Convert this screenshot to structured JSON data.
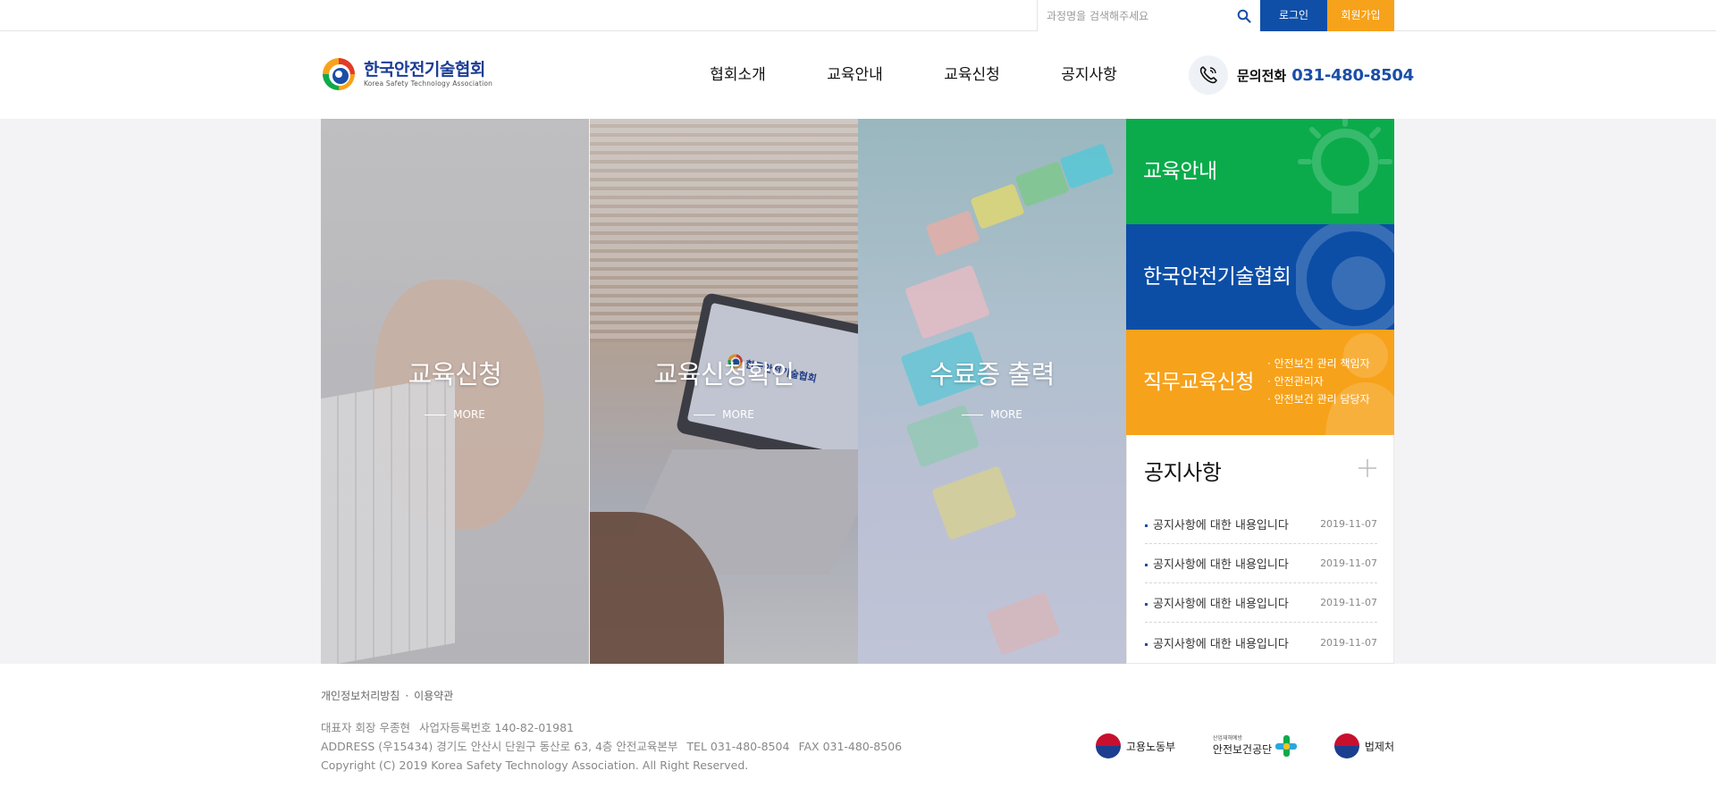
{
  "colors": {
    "primary_blue": "#0f4fa8",
    "orange": "#f7a21b",
    "green": "#0bab4b"
  },
  "top": {
    "search_placeholder": "과정명을 검색해주세요",
    "login": "로그인",
    "join": "회원가입"
  },
  "header": {
    "logo_ko": "한국안전기술협회",
    "logo_en": "Korea Safety Technology Association",
    "nav": [
      "협회소개",
      "교육안내",
      "교육신청",
      "공지사항"
    ],
    "contact_label": "문의전화",
    "contact_number": "031-480-8504"
  },
  "panels": [
    {
      "title": "교육신청",
      "more": "MORE"
    },
    {
      "title": "교육신청확인",
      "more": "MORE"
    },
    {
      "title": "수료증 출력",
      "more": "MORE"
    }
  ],
  "laptop_logo": "한국안전기술협회",
  "side": {
    "edu_info": "교육안내",
    "association": "한국안전기술협회",
    "job_training": "직무교육신청",
    "job_items": [
      "안전보건 관리 책임자",
      "안전관리자",
      "안전보건 관리 담당자"
    ]
  },
  "notice": {
    "title": "공지사항",
    "items": [
      {
        "text": "공지사항에 대한 내용입니다",
        "date": "2019-11-07"
      },
      {
        "text": "공지사항에 대한 내용입니다",
        "date": "2019-11-07"
      },
      {
        "text": "공지사항에 대한 내용입니다",
        "date": "2019-11-07"
      },
      {
        "text": "공지사항에 대한 내용입니다",
        "date": "2019-11-07"
      }
    ]
  },
  "footer": {
    "privacy": "개인정보처리방침",
    "terms": "이용약관",
    "ceo": "대표자 회장 우종현",
    "bizno": "사업자등록번호 140-82-01981",
    "address": "ADDRESS (우15434) 경기도 안산시 단원구 동산로 63, 4층 안전교육본부",
    "tel": "TEL 031-480-8504",
    "fax": "FAX 031-480-8506",
    "copyright": "Copyright (C) 2019 Korea Safety Technology Association. All Right Reserved.",
    "logos": [
      "고용노동부",
      "안전보건공단",
      "법제처"
    ],
    "kosha_sub": "산업재해예방"
  }
}
